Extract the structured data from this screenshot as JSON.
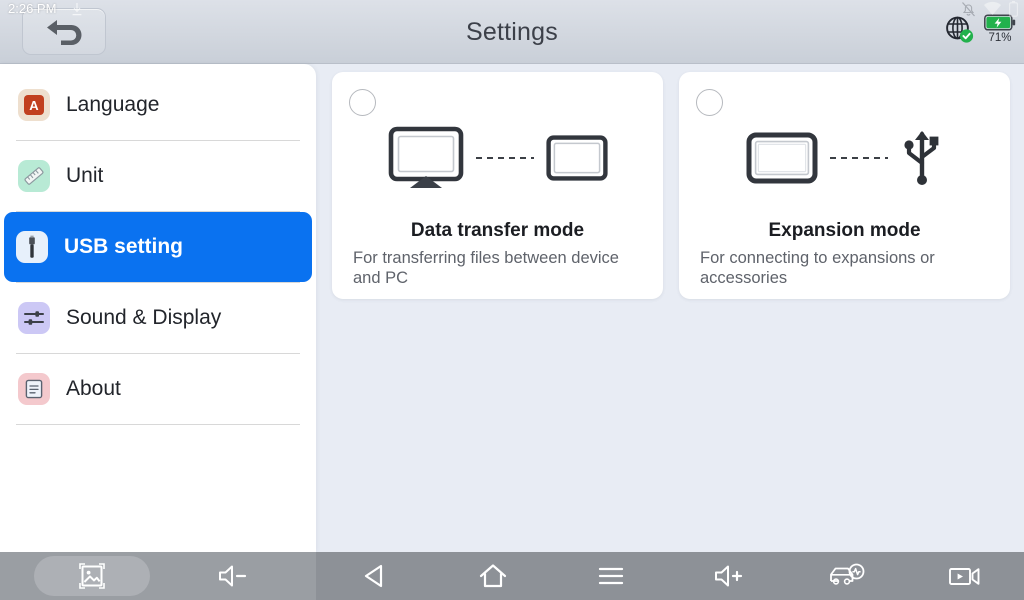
{
  "statusbar": {
    "time": "2:26 PM",
    "download_icon": "download-icon",
    "bell_muted_icon": "bell-muted-icon",
    "wifi_icon": "wifi-icon",
    "battery_small_icon": "battery-icon",
    "network_icon": "globe-connected-icon",
    "battery_percent": "71%",
    "battery_charging_color": "#22b14c",
    "check_color": "#22b14c"
  },
  "header": {
    "title": "Settings",
    "back_icon": "back-arrow-icon",
    "background_color": "#d2d7df",
    "title_color": "#3c4049"
  },
  "sidebar": {
    "accent_color": "#0a72f0",
    "items": [
      {
        "label": "Language",
        "icon": "language-icon",
        "selected": false
      },
      {
        "label": "Unit",
        "icon": "ruler-icon",
        "selected": false
      },
      {
        "label": "USB setting",
        "icon": "usb-plug-icon",
        "selected": true
      },
      {
        "label": "Sound & Display",
        "icon": "sliders-icon",
        "selected": false
      },
      {
        "label": "About",
        "icon": "document-icon",
        "selected": false
      }
    ]
  },
  "main": {
    "background_color": "#e8ecf4",
    "cards": [
      {
        "title": "Data transfer mode",
        "description": "For transferring files between device and PC",
        "selected": false,
        "radio_name": "radio-data-transfer-mode",
        "art": {
          "left_icon": "monitor-icon",
          "connector": "dashed-line",
          "right_icon": "tablet-icon"
        }
      },
      {
        "title": "Expansion mode",
        "description": "For connecting to expansions or accessories",
        "selected": false,
        "radio_name": "radio-expansion-mode",
        "art": {
          "left_icon": "tablet-icon",
          "connector": "dashed-line",
          "right_icon": "usb-symbol-icon"
        }
      }
    ]
  },
  "navbar": {
    "background_color": "#8d9197",
    "buttons": [
      {
        "name": "screenshot-button",
        "icon": "image-icon",
        "highlighted": true
      },
      {
        "name": "volume-down-button",
        "icon": "volume-down-icon",
        "highlighted": false
      },
      {
        "name": "back-nav-button",
        "icon": "triangle-back-icon",
        "highlighted": false
      },
      {
        "name": "home-button",
        "icon": "home-icon",
        "highlighted": false
      },
      {
        "name": "menu-button",
        "icon": "hamburger-icon",
        "highlighted": false
      },
      {
        "name": "volume-up-button",
        "icon": "volume-up-icon",
        "highlighted": false
      },
      {
        "name": "diagnostics-button",
        "icon": "car-diagnostic-icon",
        "highlighted": false
      },
      {
        "name": "record-button",
        "icon": "video-camera-icon",
        "highlighted": false
      }
    ]
  }
}
